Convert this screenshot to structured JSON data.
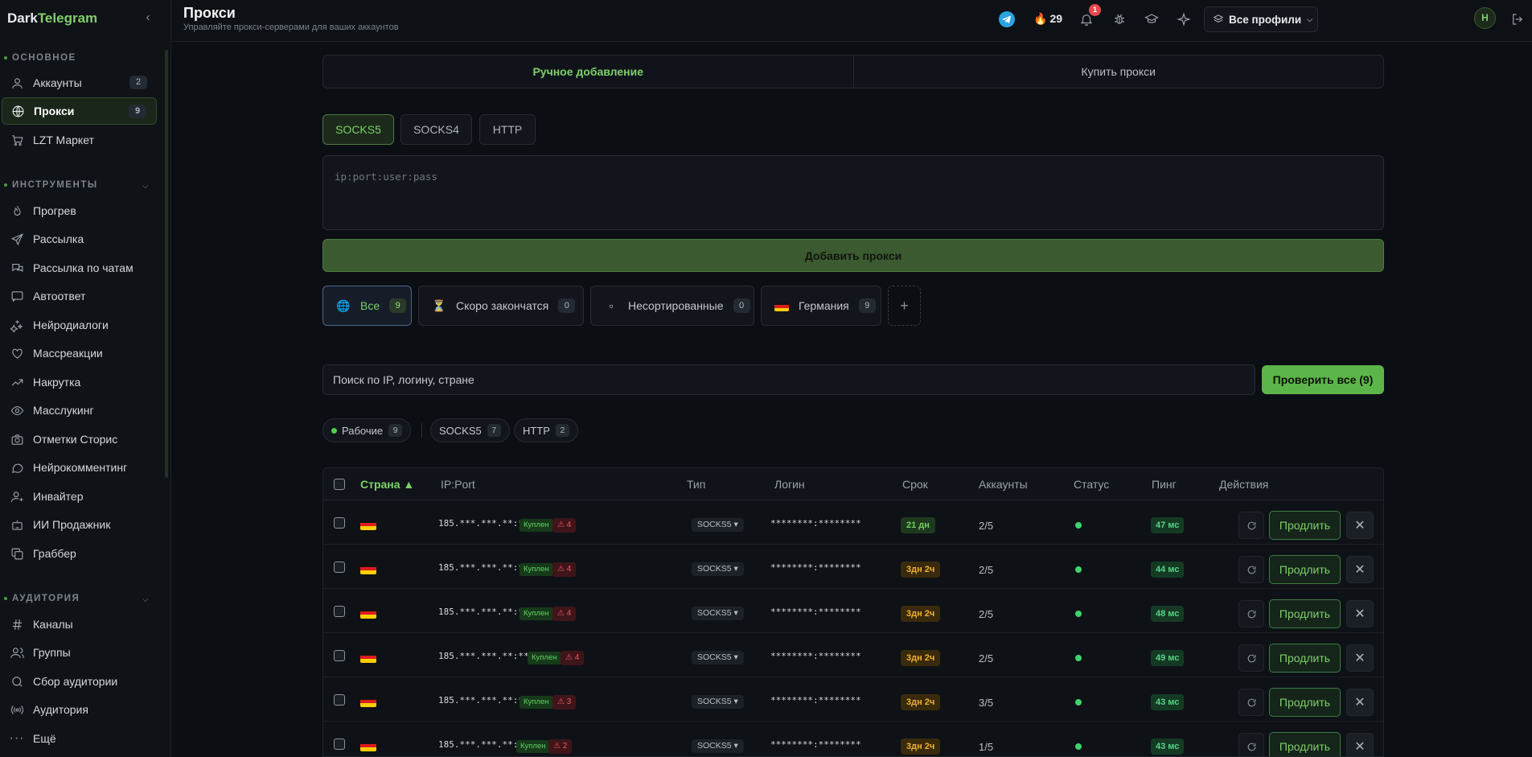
{
  "app": {
    "brand_part1": "Dark",
    "brand_part2": "Telegram"
  },
  "colors": {
    "accent": "#7fcf6a",
    "bg": "#0b0e13",
    "danger": "#e5484d",
    "warning": "#f0b230"
  },
  "sidebar": {
    "sections": [
      {
        "title": "ОСНОВНОЕ"
      },
      {
        "title": "ИНСТРУМЕНТЫ"
      },
      {
        "title": "АУДИТОРИЯ"
      }
    ],
    "main_items": [
      {
        "label": "Аккаунты",
        "badge": "2",
        "icon": "user-icon"
      },
      {
        "label": "Прокси",
        "badge": "9",
        "icon": "globe-icon",
        "active": true
      },
      {
        "label": "LZT Маркет",
        "icon": "cart-icon"
      }
    ],
    "tool_items": [
      {
        "label": "Прогрев",
        "icon": "flame-icon"
      },
      {
        "label": "Рассылка",
        "icon": "send-icon"
      },
      {
        "label": "Рассылка по чатам",
        "icon": "chats-icon"
      },
      {
        "label": "Автоответ",
        "icon": "message-icon"
      },
      {
        "label": "Нейродиалоги",
        "icon": "sparkles-icon"
      },
      {
        "label": "Массреакции",
        "icon": "heart-icon"
      },
      {
        "label": "Накрутка",
        "icon": "trend-up-icon"
      },
      {
        "label": "Масслукинг",
        "icon": "eye-icon"
      },
      {
        "label": "Отметки Сторис",
        "icon": "camera-icon"
      },
      {
        "label": "Нейрокомментинг",
        "icon": "comment-icon"
      },
      {
        "label": "Инвайтер",
        "icon": "user-plus-icon"
      },
      {
        "label": "ИИ Продажник",
        "icon": "bot-icon"
      },
      {
        "label": "Граббер",
        "icon": "copy-icon"
      }
    ],
    "audience_items": [
      {
        "label": "Каналы",
        "icon": "hash-icon"
      },
      {
        "label": "Группы",
        "icon": "users-icon"
      },
      {
        "label": "Сбор аудитории",
        "icon": "search-icon"
      },
      {
        "label": "Аудитория",
        "icon": "broadcast-icon"
      }
    ],
    "more": {
      "label": "Ещё",
      "icon": "more-icon"
    }
  },
  "header": {
    "title": "Прокси",
    "subtitle": "Управляйте прокси-серверами для ваших аккаунтов",
    "streak": "29",
    "notifications": "1",
    "profile_select": "Все профили",
    "avatar": "Н"
  },
  "tabs": [
    {
      "label": "Ручное добавление",
      "active": true
    },
    {
      "label": "Купить прокси"
    }
  ],
  "protocols": [
    {
      "label": "SOCKS5",
      "active": true
    },
    {
      "label": "SOCKS4"
    },
    {
      "label": "HTTP"
    }
  ],
  "proxy_input": {
    "placeholder": "ip:port:user:pass"
  },
  "add_button": "Добавить прокси",
  "groups": [
    {
      "label": "Все",
      "count": "9",
      "icon": "🌐",
      "active": true
    },
    {
      "label": "Скоро закончатся",
      "count": "0",
      "icon": "⏳"
    },
    {
      "label": "Несортированные",
      "count": "0",
      "icon": "▫"
    },
    {
      "label": "Германия",
      "count": "9",
      "icon": "flag-de"
    }
  ],
  "group_add": "+",
  "search": {
    "placeholder": "Поиск по IP, логину, стране"
  },
  "check_all": "Проверить все (9)",
  "filters": [
    {
      "label": "Рабочие",
      "count": "9"
    },
    {
      "label": "SOCKS5",
      "count": "7"
    },
    {
      "label": "HTTP",
      "count": "2"
    }
  ],
  "table": {
    "columns": [
      "Страна ▲",
      "IP:Port",
      "Тип",
      "Логин",
      "Срок",
      "Аккаунты",
      "Статус",
      "Пинг",
      "Действия"
    ],
    "rows": [
      {
        "ip": "185.***.***.**:*****",
        "tag": "Куплен",
        "warn": "⚠ 4",
        "type": "SOCKS5 ▾",
        "login": "********:********",
        "term": "21 дн",
        "term_color": "green",
        "accounts": "2/5",
        "ping": "47 мс"
      },
      {
        "ip": "185.***.***.**:*****",
        "tag": "Куплен",
        "warn": "⚠ 4",
        "type": "SOCKS5 ▾",
        "login": "********:********",
        "term": "3дн 2ч",
        "term_color": "orange",
        "accounts": "2/5",
        "ping": "44 мс"
      },
      {
        "ip": "185.***.***.**:*****",
        "tag": "Куплен",
        "warn": "⚠ 4",
        "type": "SOCKS5 ▾",
        "login": "********:********",
        "term": "3дн 2ч",
        "term_color": "orange",
        "accounts": "2/5",
        "ping": "48 мс"
      },
      {
        "ip": "185.***.***.**:*****",
        "tag": "Куплен",
        "warn": "⚠ 4",
        "type": "SOCKS5 ▾",
        "login": "********:********",
        "term": "3дн 2ч",
        "term_color": "orange",
        "accounts": "2/5",
        "ping": "49 мс"
      },
      {
        "ip": "185.***.***.**:*****",
        "tag": "Куплен",
        "warn": "⚠ 3",
        "type": "SOCKS5 ▾",
        "login": "********:********",
        "term": "3дн 2ч",
        "term_color": "orange",
        "accounts": "3/5",
        "ping": "43 мс"
      },
      {
        "ip": "185.***.***.**:*****",
        "tag": "Куплен",
        "warn": "⚠ 2",
        "type": "SOCKS5 ▾",
        "login": "********:********",
        "term": "3дн 2ч",
        "term_color": "orange",
        "accounts": "1/5",
        "ping": "43 мс"
      }
    ],
    "extend_label": "Продлить",
    "delete_label": "✕"
  }
}
